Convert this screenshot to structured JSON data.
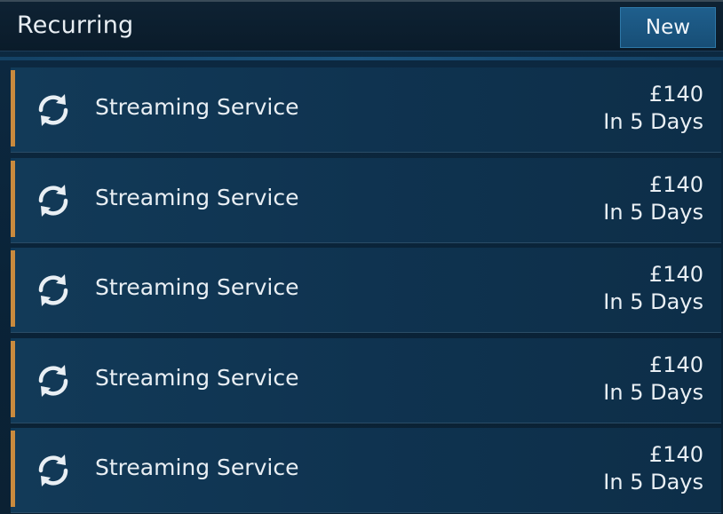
{
  "header": {
    "title": "Recurring",
    "new_label": "New"
  },
  "colors": {
    "accent": "#c98a3e",
    "button": "#1c5885",
    "background": "#0b2236"
  },
  "items": [
    {
      "icon": "recurring-icon",
      "name": "Streaming Service",
      "amount": "£140",
      "due": "In 5 Days"
    },
    {
      "icon": "recurring-icon",
      "name": "Streaming Service",
      "amount": "£140",
      "due": "In 5 Days"
    },
    {
      "icon": "recurring-icon",
      "name": "Streaming Service",
      "amount": "£140",
      "due": "In 5 Days"
    },
    {
      "icon": "recurring-icon",
      "name": "Streaming Service",
      "amount": "£140",
      "due": "In 5 Days"
    },
    {
      "icon": "recurring-icon",
      "name": "Streaming Service",
      "amount": "£140",
      "due": "In 5 Days"
    }
  ]
}
